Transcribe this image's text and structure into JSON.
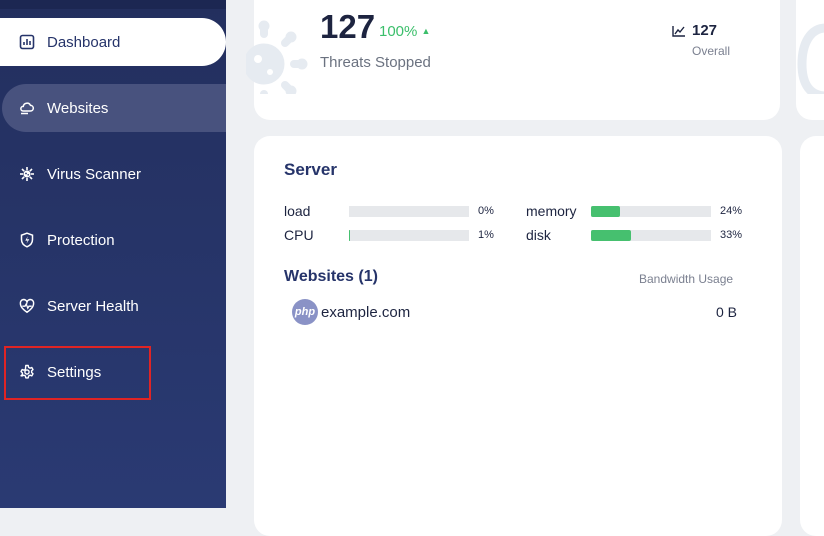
{
  "sidebar": {
    "items": [
      {
        "label": "Dashboard",
        "icon": "bar-chart-icon",
        "state": "active"
      },
      {
        "label": "Websites",
        "icon": "cloud-icon",
        "state": "hover"
      },
      {
        "label": "Virus Scanner",
        "icon": "virus-icon",
        "state": "normal"
      },
      {
        "label": "Protection",
        "icon": "shield-icon",
        "state": "normal"
      },
      {
        "label": "Server Health",
        "icon": "heart-pulse-icon",
        "state": "normal"
      },
      {
        "label": "Settings",
        "icon": "gear-icon",
        "state": "normal"
      }
    ]
  },
  "threats": {
    "count": "127",
    "change": "100%",
    "caption": "Threats Stopped",
    "overall_value": "127",
    "overall_label": "Overall"
  },
  "server": {
    "title": "Server",
    "metrics": [
      {
        "label": "load",
        "value": "0%",
        "fraction": 0
      },
      {
        "label": "CPU",
        "value": "1%",
        "fraction": 0.01
      },
      {
        "label": "memory",
        "value": "24%",
        "fraction": 0.24
      },
      {
        "label": "disk",
        "value": "33%",
        "fraction": 0.33
      }
    ]
  },
  "websites": {
    "title": "Websites (1)",
    "column_label": "Bandwidth Usage",
    "rows": [
      {
        "logo_text": "php",
        "name": "example.com",
        "bandwidth": "0 B"
      }
    ]
  },
  "colors": {
    "sidebar": "#26346a",
    "accent_green": "#46c06f",
    "highlight_red": "#e02424"
  }
}
